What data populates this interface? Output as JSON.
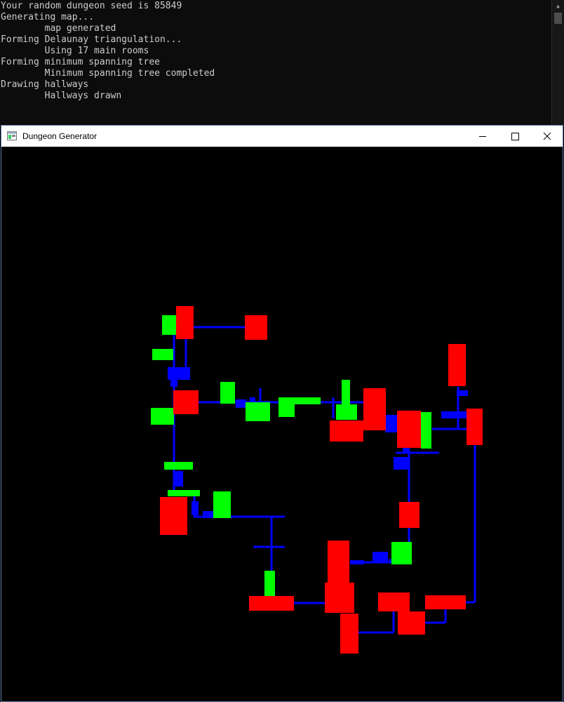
{
  "console": {
    "lines": [
      "Your random dungeon seed is 85849",
      "Generating map...",
      "        map generated",
      "Forming Delaunay triangulation...",
      "        Using 17 main rooms",
      "Forming minimum spanning tree",
      "        Minimum spanning tree completed",
      "Drawing hallways",
      "        Hallways drawn"
    ],
    "text_color": "#cccccc",
    "background": "#0c0c0c"
  },
  "window": {
    "title": "Dungeon Generator",
    "app_icon": "window-app-icon",
    "controls": [
      {
        "name": "minimize-button",
        "icon": "minimize-icon"
      },
      {
        "name": "maximize-button",
        "icon": "maximize-icon"
      },
      {
        "name": "close-button",
        "icon": "close-icon"
      }
    ]
  },
  "dungeon": {
    "colors": {
      "main_room": "#ff0000",
      "side_room": "#00ff00",
      "hallway": "#0000ff",
      "background": "#000000"
    }
  }
}
